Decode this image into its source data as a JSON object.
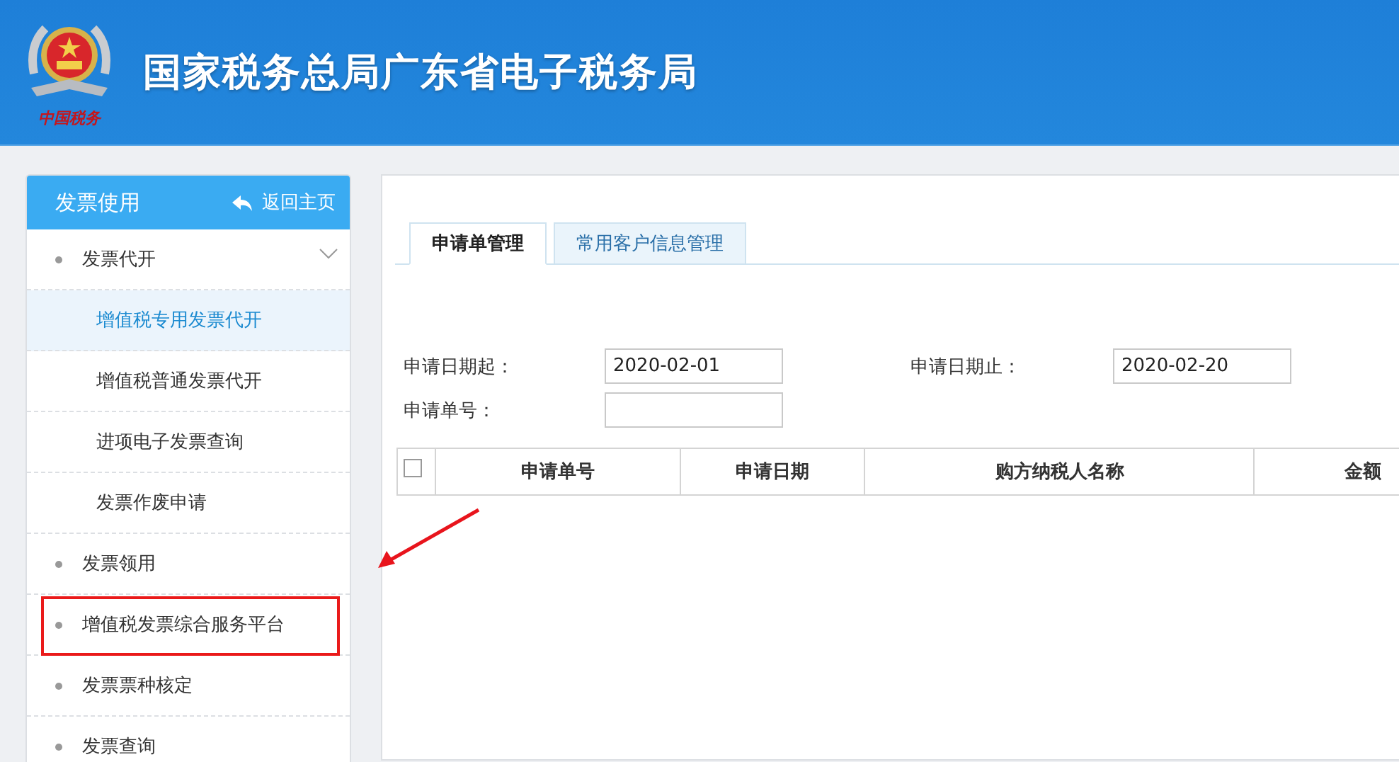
{
  "header": {
    "title": "国家税务总局广东省电子税务局",
    "logo_caption": "中国税务"
  },
  "sidebar": {
    "title": "发票使用",
    "back_link": "返回主页",
    "items": [
      {
        "label": "发票代开",
        "expanded": true,
        "highlighted": false,
        "children": [
          {
            "label": "增值税专用发票代开",
            "selected": true
          },
          {
            "label": "增值税普通发票代开",
            "selected": false
          },
          {
            "label": "进项电子发票查询",
            "selected": false
          },
          {
            "label": "发票作废申请",
            "selected": false
          }
        ]
      },
      {
        "label": "发票领用",
        "highlighted": false
      },
      {
        "label": "增值税发票综合服务平台",
        "highlighted": true
      },
      {
        "label": "发票票种核定",
        "highlighted": false
      },
      {
        "label": "发票查询",
        "highlighted": false
      }
    ]
  },
  "tabs": [
    {
      "label": "申请单管理",
      "selected": true
    },
    {
      "label": "常用客户信息管理",
      "selected": false
    }
  ],
  "form": {
    "fields": [
      {
        "label": "申请日期起：",
        "value": "2020-02-01"
      },
      {
        "label": "申请日期止：",
        "value": "2020-02-20"
      },
      {
        "label": "申请单号："
      }
    ]
  },
  "table": {
    "select_all_checked": false,
    "columns": [
      "申请单号",
      "申请日期",
      "购方纳税人名称",
      "金额"
    ]
  }
}
